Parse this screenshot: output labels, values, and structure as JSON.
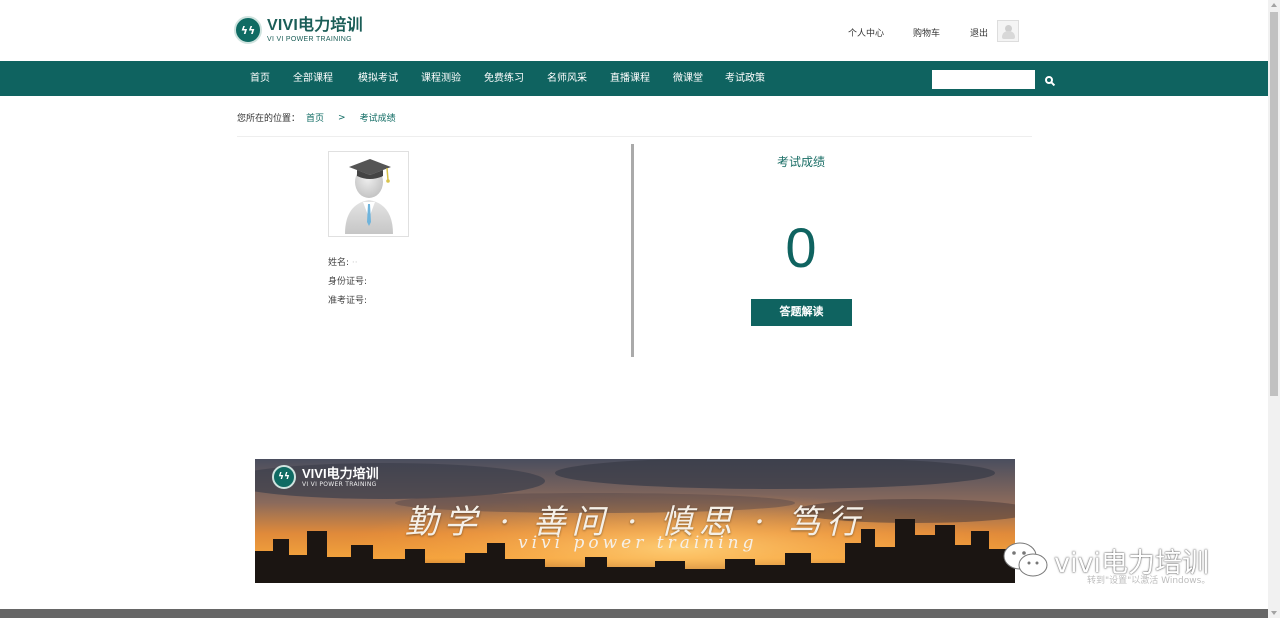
{
  "header": {
    "logo_main": "VIVI电力培训",
    "logo_sub": "VI VI POWER TRAINING",
    "links": {
      "profile": "个人中心",
      "cart": "购物车",
      "logout": "退出"
    }
  },
  "nav": {
    "items": [
      "首页",
      "全部课程",
      "模拟考试",
      "课程测验",
      "免费练习",
      "名师风采",
      "直播课程",
      "微课堂",
      "考试政策"
    ],
    "search_placeholder": ""
  },
  "breadcrumb": {
    "prefix": "您所在的位置：",
    "home": "首页",
    "separator": ">",
    "current": "考试成绩"
  },
  "student": {
    "name_label": "姓名:",
    "name_value": "··",
    "id_label": "身份证号:",
    "ticket_label": "准考证号:"
  },
  "result": {
    "title": "考试成绩",
    "score": "0",
    "button": "答题解读"
  },
  "banner": {
    "logo_main": "VIVI电力培训",
    "logo_sub": "VI VI POWER TRAINING",
    "slogan": "勤学 · 善问 · 慎思 · 笃行",
    "sub": "vivi power training"
  },
  "watermark": {
    "text": "vivi电力培训",
    "os_notice": "转到\"设置\"以激活 Windows。"
  },
  "colors": {
    "brand": "#0f6360",
    "nav_bg": "#0f6360",
    "accent_text": "#0f6b63"
  }
}
